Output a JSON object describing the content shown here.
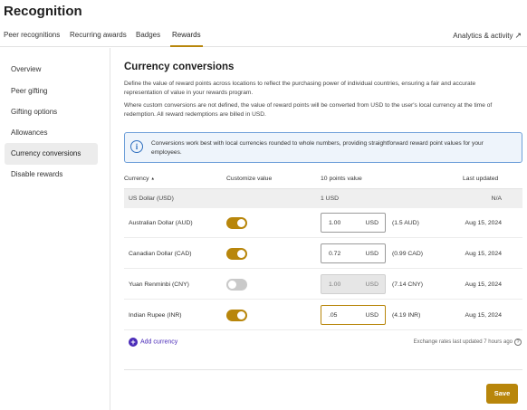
{
  "app": {
    "title": "Recognition"
  },
  "top_tabs": [
    {
      "label": "Peer recognitions",
      "active": false
    },
    {
      "label": "Recurring awards",
      "active": false
    },
    {
      "label": "Badges",
      "active": false
    },
    {
      "label": "Rewards",
      "active": true
    }
  ],
  "analytics_link": {
    "label": "Analytics & activity",
    "icon": "external-arrow-icon"
  },
  "sidebar": {
    "items": [
      {
        "label": "Overview",
        "active": false
      },
      {
        "label": "Peer gifting",
        "active": false
      },
      {
        "label": "Gifting options",
        "active": false
      },
      {
        "label": "Allowances",
        "active": false
      },
      {
        "label": "Currency conversions",
        "active": true
      },
      {
        "label": "Disable rewards",
        "active": false
      }
    ]
  },
  "main": {
    "title": "Currency conversions",
    "description_1": "Define the value of reward points across locations to reflect the purchasing power of individual countries, ensuring a fair and accurate representation of value in your rewards program.",
    "description_2": "Where custom conversions are not defined, the value of reward points will be converted from USD to the user's local currency at the time of redemption. All reward redemptions are billed in USD.",
    "info_text": "Conversions work best with local currencies rounded to whole numbers, providing straightforward reward point values for your employees.",
    "info_icon": "info-icon"
  },
  "table": {
    "headers": {
      "currency": "Currency",
      "sort_indicator": "▲",
      "customize": "Customize value",
      "points": "10 points value",
      "updated": "Last updated"
    },
    "base_row": {
      "currency": "US Dollar (USD)",
      "value": "1 USD",
      "updated": "N/A"
    },
    "rows": [
      {
        "currency": "Australian Dollar (AUD)",
        "enabled": true,
        "value": "1.00",
        "unit": "USD",
        "converted": "(1.5 AUD)",
        "updated": "Aug 15, 2024"
      },
      {
        "currency": "Canadian Dollar (CAD)",
        "enabled": true,
        "value": "0.72",
        "unit": "USD",
        "converted": "(0.99 CAD)",
        "updated": "Aug 15, 2024"
      },
      {
        "currency": "Yuan Renminbi (CNY)",
        "enabled": false,
        "value": "1.00",
        "unit": "USD",
        "converted": "(7.14 CNY)",
        "updated": "Aug 15, 2024"
      },
      {
        "currency": "Indian Rupee (INR)",
        "enabled": true,
        "value": ".05",
        "unit": "USD",
        "converted": "(4.19 INR)",
        "updated": "Aug 15, 2024"
      }
    ]
  },
  "footer": {
    "add_currency_label": "Add currency",
    "rates_note": "Exchange rates last updated 7 hours ago",
    "save_label": "Save"
  },
  "colors": {
    "accent": "#b8860b",
    "link": "#4a2bb8",
    "info_border": "#6e9fd9",
    "info_bg": "#eef4fb"
  }
}
